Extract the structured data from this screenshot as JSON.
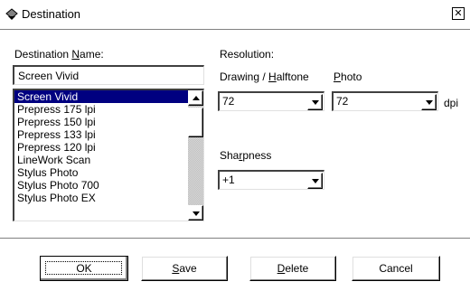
{
  "window": {
    "title": "Destination",
    "close_glyph": "✕"
  },
  "destination_name": {
    "label_before": "Destination ",
    "label_underlined": "N",
    "label_after": "ame:",
    "value": "Screen Vivid",
    "list": [
      "Screen Vivid",
      "Prepress 175 lpi",
      "Prepress 150 lpi",
      "Prepress 133 lpi",
      "Prepress 120 lpi",
      "LineWork Scan",
      "Stylus Photo",
      "Stylus Photo 700",
      "Stylus Photo EX"
    ],
    "selected_index": 0
  },
  "resolution": {
    "label": "Resolution:",
    "drawing": {
      "label_before": "Drawing / ",
      "label_underlined": "H",
      "label_after": "alftone",
      "value": "72"
    },
    "photo": {
      "label_before": "",
      "label_underlined": "P",
      "label_after": "hoto",
      "value": "72"
    },
    "unit": "dpi"
  },
  "sharpness": {
    "label_before": "Sha",
    "label_underlined": "r",
    "label_after": "pness",
    "value": "+1"
  },
  "buttons": {
    "ok": {
      "before": "",
      "underlined": "",
      "after": "OK"
    },
    "save": {
      "before": "",
      "underlined": "S",
      "after": "ave"
    },
    "delete": {
      "before": "",
      "underlined": "D",
      "after": "elete"
    },
    "cancel": {
      "before": "",
      "underlined": "",
      "after": "Cancel"
    }
  },
  "icons": {
    "app": "scanner-icon",
    "close": "close-icon",
    "scroll_up": "arrow-up-icon",
    "scroll_down": "arrow-down-icon",
    "dropdown": "dropdown-arrow-icon"
  }
}
